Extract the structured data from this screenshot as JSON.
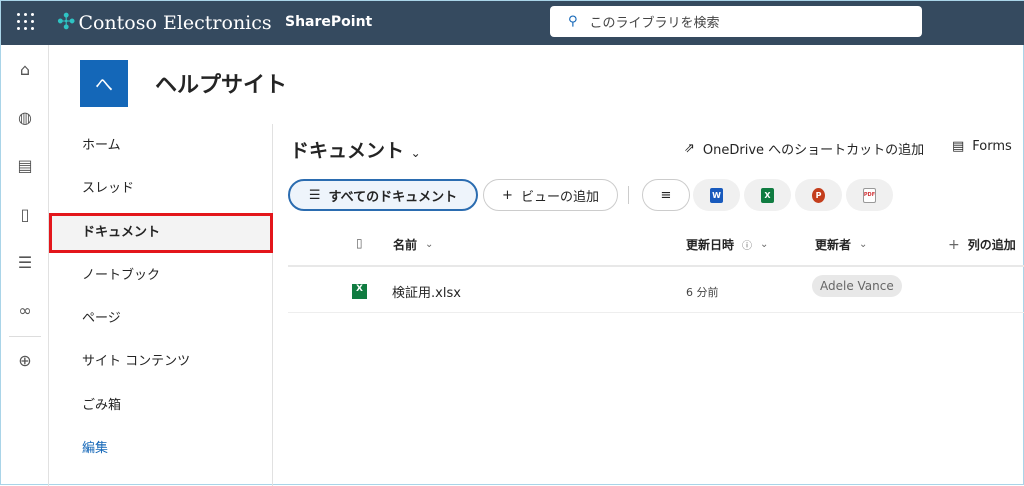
{
  "header": {
    "brand": "Contoso Electronics",
    "app": "SharePoint",
    "search_placeholder": "このライブラリを検索"
  },
  "site": {
    "icon_letter": "へ",
    "title": "ヘルプサイト"
  },
  "nav": [
    {
      "label": "ホーム"
    },
    {
      "label": "スレッド"
    },
    {
      "label": "ドキュメント",
      "selected": true
    },
    {
      "label": "ノートブック"
    },
    {
      "label": "ページ"
    },
    {
      "label": "サイト コンテンツ"
    },
    {
      "label": "ごみ箱"
    },
    {
      "label": "編集"
    }
  ],
  "library": {
    "title": "ドキュメント",
    "onedrive_shortcut": "OneDrive へのショートカットの追加",
    "forms": "Forms",
    "view_all": "すべてのドキュメント",
    "add_view": "ビューの追加"
  },
  "apps": [
    {
      "letter": "W",
      "color": "#185abd"
    },
    {
      "letter": "X",
      "color": "#107c41"
    },
    {
      "letter": "P",
      "color": "#c43e1c"
    },
    {
      "letter": "PDF",
      "color": "#d13438"
    }
  ],
  "columns": {
    "name": "名前",
    "modified": "更新日時",
    "modified_by": "更新者",
    "add_column": "列の追加"
  },
  "files": [
    {
      "name": "検証用.xlsx",
      "modified": "6 分前",
      "modified_by": "Adele Vance"
    }
  ]
}
